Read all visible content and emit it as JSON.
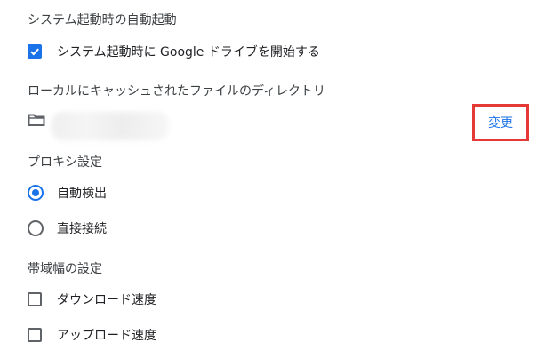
{
  "startup": {
    "title": "システム起動時の自動起動",
    "launch_option": {
      "label": "システム起動時に Google ドライブを開始する",
      "checked": true
    }
  },
  "cache": {
    "title": "ローカルにキャッシュされたファイルのディレクトリ",
    "folder_icon": "folder-icon",
    "change_label": "変更"
  },
  "proxy": {
    "title": "プロキシ設定",
    "options": [
      {
        "label": "自動検出",
        "selected": true
      },
      {
        "label": "直接接続",
        "selected": false
      }
    ]
  },
  "bandwidth": {
    "title": "帯域幅の設定",
    "options": [
      {
        "label": "ダウンロード速度",
        "checked": false
      },
      {
        "label": "アップロード速度",
        "checked": false
      }
    ]
  },
  "colors": {
    "accent": "#1a73e8",
    "highlight_border": "#e53935"
  }
}
